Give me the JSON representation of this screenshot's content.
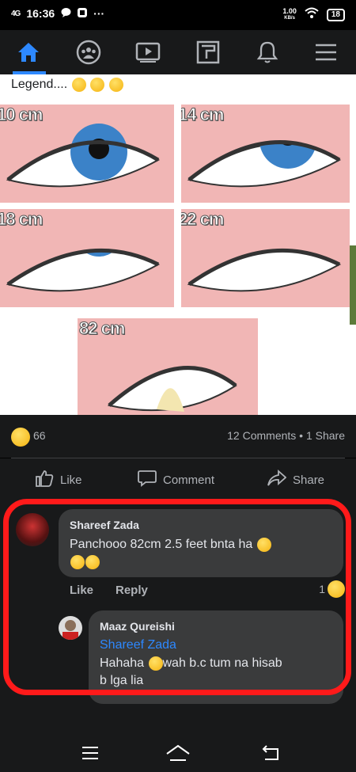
{
  "status_bar": {
    "signal": "4G",
    "time": "16:36",
    "more": "···",
    "speed_value": "1.00",
    "speed_unit": "KB/s",
    "battery": "18"
  },
  "nav": {
    "items": [
      "home-icon",
      "groups-icon",
      "watch-icon",
      "marketplace-icon",
      "notifications-icon",
      "menu-icon"
    ],
    "active_color": "#2d88ff"
  },
  "post": {
    "caption": "Legend....",
    "image_labels": [
      "10 cm",
      "14 cm",
      "18 cm",
      "22 cm",
      "82 cm"
    ],
    "reaction_count": "66",
    "comments_share": "12 Comments • 1 Share",
    "actions": {
      "like": "Like",
      "comment": "Comment",
      "share": "Share"
    }
  },
  "comments": [
    {
      "name": "Shareef Zada",
      "text": "Panchooo 82cm 2.5 feet bnta ha",
      "like": "Like",
      "reply": "Reply",
      "reaction_count": "1"
    },
    {
      "name": "Maaz Qureishi",
      "tag": "Shareef Zada",
      "text_line1": "Hahaha",
      "text_line1b": "wah b.c tum na hisab",
      "text_line2": "b lga lia"
    }
  ],
  "colors": {
    "background": "#18191a",
    "bubble": "#3a3b3c",
    "accent": "#2d88ff",
    "annotation": "#ff1a1a"
  }
}
